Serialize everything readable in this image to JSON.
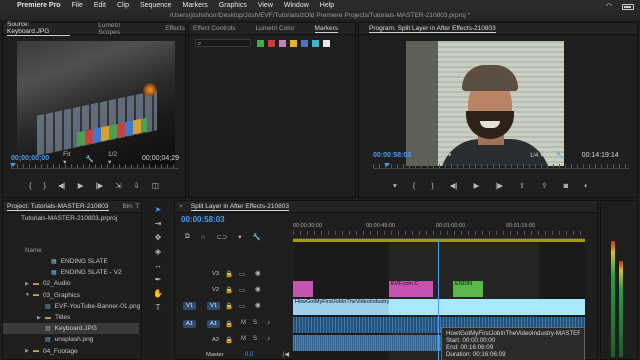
{
  "menubar": {
    "app_name": "Premiere Pro",
    "items": [
      "File",
      "Edit",
      "Clip",
      "Sequence",
      "Markers",
      "Graphics",
      "View",
      "Window",
      "Help"
    ]
  },
  "path": "/Users/joshshorr/Desktop/Josh/EVF/Tutorials/zOld Premiere Projects/Tutorials-MASTER-210803.prproj *",
  "source_panel": {
    "tabs": [
      "Source: Keyboard.JPG",
      "Lumetri Scopes",
      "Effects"
    ],
    "timecode": "00;00;00;00",
    "fit": "Fit",
    "ratio": "1/2",
    "end_timecode": "00;00;04;29"
  },
  "effects_panel": {
    "tabs": [
      "Effect Controls",
      "Lumetri Color",
      "Markers"
    ],
    "swatch_colors": [
      "#3cae4a",
      "#c04040",
      "#c080c0",
      "#e8b030",
      "#4b72c4",
      "#3fb6c8",
      "#e8e8e8"
    ]
  },
  "program_panel": {
    "title": "Program: Split Layer in After Effects-210803",
    "timecode": "00:00:58:03",
    "fit": "Fit",
    "ratio": "1/4",
    "end_timecode": "00:14:19:14"
  },
  "project_panel": {
    "tabs": [
      "Project: Tutorials-MASTER-210803",
      "Bin: T"
    ],
    "file": "Tutorials-MASTER-210803.prproj",
    "column": "Name",
    "items": [
      {
        "label": "ENDING SLATE",
        "kind": "doc",
        "indent": 3
      },
      {
        "label": "ENDING SLATE - V2",
        "kind": "doc",
        "indent": 3
      },
      {
        "label": "02_Audio",
        "kind": "folder",
        "indent": 1
      },
      {
        "label": "03_Graphics",
        "kind": "folder",
        "indent": 1,
        "open": true
      },
      {
        "label": "EVF-YouTube-Banner-01.png",
        "kind": "doc",
        "indent": 2
      },
      {
        "label": "Titles",
        "kind": "folder",
        "indent": 2
      },
      {
        "label": "Keyboard.JPG",
        "kind": "doc",
        "indent": 2,
        "selected": true
      },
      {
        "label": "unsplash.png",
        "kind": "doc",
        "indent": 2
      },
      {
        "label": "04_Footage",
        "kind": "folder",
        "indent": 1
      }
    ]
  },
  "timeline": {
    "title": "Split Layer in After Effects-210803",
    "timecode": "00:00:58:03",
    "ruler_labels": [
      "00:00:30:00",
      "00:00:45:00",
      "00:01:00:00",
      "00:01:15:00"
    ],
    "tracks": [
      {
        "id": "V3",
        "label": "V3"
      },
      {
        "id": "V2",
        "label": "V2"
      },
      {
        "id": "V1",
        "label": "V1",
        "src": "V1"
      },
      {
        "id": "A1",
        "label": "A1",
        "src": "A1"
      },
      {
        "id": "A2",
        "label": "A2"
      },
      {
        "id": "Master",
        "label": "Master",
        "value": "0.0"
      }
    ],
    "clip_v1_label": "HowGotMyFirstJobInTheVideoIndustry-MASTER-210205.mp4 [V]",
    "clip_evf": "EVF.com C",
    "clip_endin": "ENDIN",
    "tooltip": {
      "name": "HowIGotMyFirstJobInTheVideoIndustry-MASTER-210205.mp4 [V]",
      "start": "Start: 00:00:00:00",
      "end": "End: 00:16:06:09",
      "duration": "Duration: 00:16:06:09"
    }
  }
}
